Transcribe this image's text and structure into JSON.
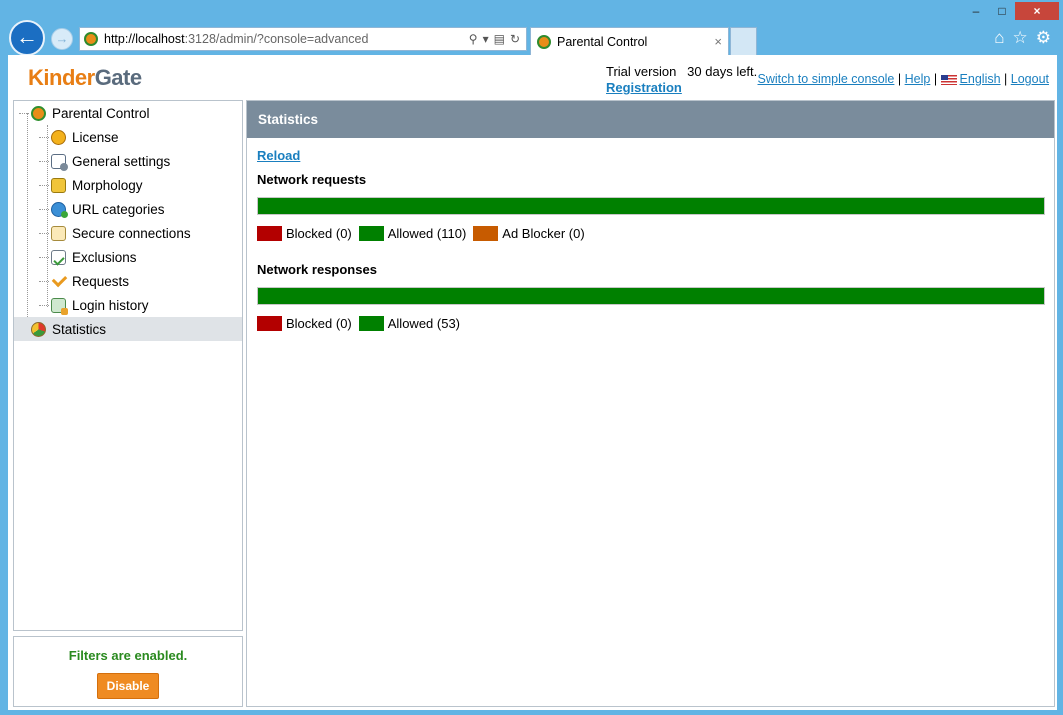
{
  "browser": {
    "url_host": "http://localhost",
    "url_rest": ":3128/admin/?console=advanced",
    "tab_title": "Parental Control",
    "tab_close": "×",
    "window_controls": [
      "–",
      "□",
      "×"
    ],
    "chrome_icons": [
      "home-icon",
      "star-icon",
      "gear-icon"
    ]
  },
  "header": {
    "logo_part1": "Kinder",
    "logo_part2": "Gate",
    "trial_text": "Trial version",
    "trial_days": "30 days left.",
    "registration": "Registration",
    "links": {
      "simple_console": "Switch to simple console",
      "sep": "|",
      "help": "Help",
      "language": "English",
      "logout": "Logout"
    }
  },
  "sidebar": {
    "root": "Parental Control",
    "items": [
      {
        "label": "License",
        "icon": "license-icon"
      },
      {
        "label": "General settings",
        "icon": "settings-icon"
      },
      {
        "label": "Morphology",
        "icon": "morphology-icon"
      },
      {
        "label": "URL categories",
        "icon": "url-categories-icon"
      },
      {
        "label": "Secure connections",
        "icon": "secure-connections-icon"
      },
      {
        "label": "Exclusions",
        "icon": "exclusions-icon"
      },
      {
        "label": "Requests",
        "icon": "requests-icon"
      },
      {
        "label": "Login history",
        "icon": "login-history-icon"
      }
    ],
    "selected": "Statistics",
    "status": "Filters are enabled.",
    "disable_button": "Disable"
  },
  "main": {
    "title": "Statistics",
    "reload": "Reload",
    "requests": {
      "title": "Network requests",
      "legend": [
        {
          "label": "Blocked (0)",
          "color": "#b30000",
          "value": 0
        },
        {
          "label": "Allowed (110)",
          "color": "#008000",
          "value": 110
        },
        {
          "label": "Ad Blocker (0)",
          "color": "#c75b00",
          "value": 0
        }
      ]
    },
    "responses": {
      "title": "Network responses",
      "legend": [
        {
          "label": "Blocked (0)",
          "color": "#b30000",
          "value": 0
        },
        {
          "label": "Allowed (53)",
          "color": "#008000",
          "value": 53
        }
      ]
    }
  }
}
